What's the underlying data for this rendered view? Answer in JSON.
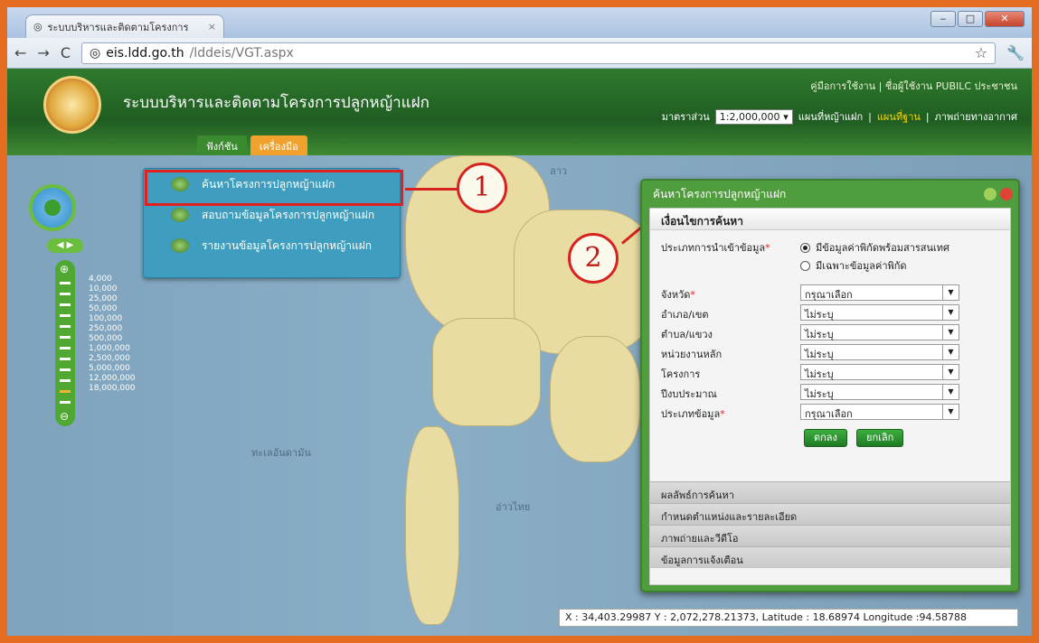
{
  "browser": {
    "tab_title": "ระบบบริหารและติดตามโครงการ",
    "tab_close": "×",
    "url_host": "eis.ldd.go.th",
    "url_path": "/lddeis/VGT.aspx"
  },
  "header": {
    "site_title": "ระบบบริหารและติดตามโครงการปลูกหญ้าแฝก",
    "links": "คู่มือการใช้งาน | ชื่อผู้ใช้งาน PUBILC ประชาชน",
    "scale_label": "มาตราส่วน",
    "scale_value": "1:2,000,000",
    "map_link": "แผนที่หญ้าแฝก",
    "base_link": "แผนที่ฐาน",
    "photo_link": "ภาพถ่ายทางอากาศ",
    "menu": [
      "ฟังก์ชัน",
      "เครื่องมือ"
    ]
  },
  "zoom_levels": [
    "4,000",
    "10,000",
    "25,000",
    "50,000",
    "100,000",
    "250,000",
    "500,000",
    "1,000,000",
    "2,500,000",
    "5,000,000",
    "12,000,000",
    "18,000,000"
  ],
  "dropdown": {
    "items": [
      "ค้นหาโครงการปลูกหญ้าแฝก",
      "สอบถามข้อมูลโครงการปลูกหญ้าแฝก",
      "รายงานข้อมูลโครงการปลูกหญ้าแฝก"
    ]
  },
  "callouts": {
    "one": "1",
    "two": "2"
  },
  "panel": {
    "title": "ค้นหาโครงการปลูกหญ้าแฝก",
    "section": "เงื่อนไขการค้นหา",
    "import_label": "ประเภทการนำเข้าข้อมูล",
    "option1": "มีข้อมูลค่าพิกัดพร้อมสารสนเทศ",
    "option2": "มีเฉพาะข้อมูลค่าพิกัด",
    "fields": [
      {
        "label": "จังหวัด",
        "value": "กรุณาเลือก"
      },
      {
        "label": "อำเภอ/เขต",
        "value": "ไม่ระบุ"
      },
      {
        "label": "ตำบล/แขวง",
        "value": "ไม่ระบุ"
      },
      {
        "label": "หน่วยงานหลัก",
        "value": "ไม่ระบุ"
      },
      {
        "label": "โครงการ",
        "value": "ไม่ระบุ"
      },
      {
        "label": "ปีงบประมาณ",
        "value": "ไม่ระบุ"
      },
      {
        "label": "ประเภทข้อมูล",
        "value": "กรุณาเลือก"
      }
    ],
    "ok": "ตกลง",
    "cancel": "ยกเลิก",
    "accordion": [
      "ผลลัพธ์การค้นหา",
      "กำหนดตำแหน่งและรายละเอียด",
      "ภาพถ่ายและวีดีโอ",
      "ข้อมูลการแจ้งเตือน"
    ]
  },
  "map_labels": [
    "ลาว",
    "ทะเลอันดามัน",
    "อ่าวไทย"
  ],
  "coords": "X : 34,403.29987 Y : 2,072,278.21373, Latitude : 18.68974 Longitude :94.58788"
}
